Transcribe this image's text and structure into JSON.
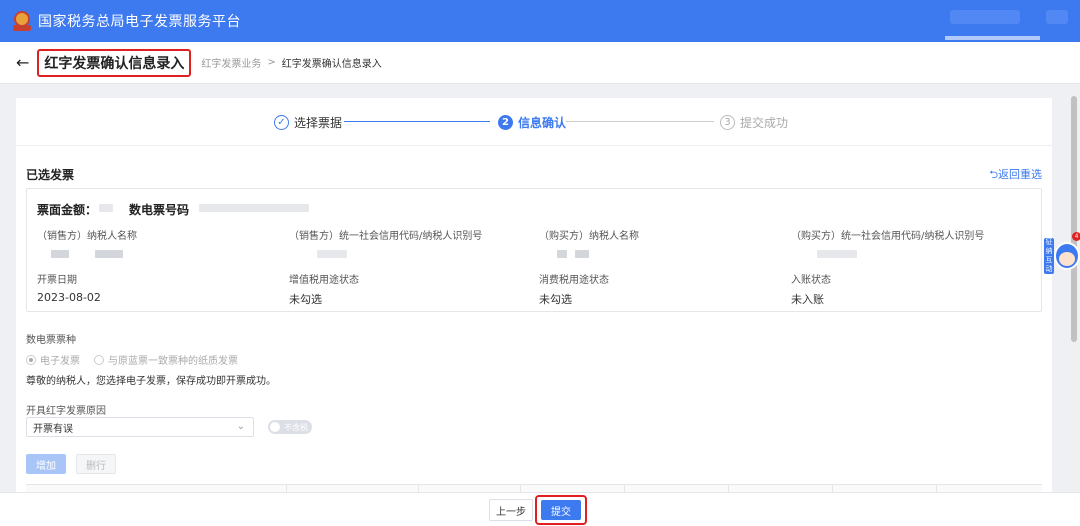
{
  "app": {
    "title": "国家税务总局电子发票服务平台"
  },
  "colors": {
    "primary": "#3d7af0",
    "highlight": "#e02020"
  },
  "header": {
    "page_title": "红字发票确认信息录入",
    "breadcrumb": [
      "红字发票业务",
      "红字发票确认信息录入"
    ],
    "breadcrumb_sep": ">",
    "back_icon": "arrow-left-icon"
  },
  "steps": [
    {
      "icon": "✓",
      "label": "选择票据",
      "state": "done"
    },
    {
      "icon": "2",
      "label": "信息确认",
      "state": "active"
    },
    {
      "icon": "3",
      "label": "提交成功",
      "state": "pending"
    }
  ],
  "selected": {
    "title": "已选发票",
    "reselect": "⮌返回重选",
    "amount_label": "票面金额：",
    "number_label": "数电票号码",
    "seller_name_label": "（销售方）纳税人名称",
    "seller_id_label": "（销售方）统一社会信用代码/纳税人识别号",
    "buyer_name_label": "（购买方）纳税人名称",
    "buyer_id_label": "（购买方）统一社会信用代码/纳税人识别号",
    "issue_date_label": "开票日期",
    "issue_date": "2023-08-02",
    "vat_label": "增值税用途状态",
    "vat_value": "未勾选",
    "consume_label": "消费税用途状态",
    "consume_value": "未勾选",
    "account_label": "入账状态",
    "account_value": "未入账"
  },
  "invoice_type": {
    "label": "数电票票种",
    "options": [
      "电子发票",
      "与原蓝票一致票种的纸质发票"
    ],
    "selected": "电子发票",
    "hint": "尊敬的纳税人，您选择电子发票，保存成功即开票成功。"
  },
  "reason": {
    "label": "开具红字发票原因",
    "value": "开票有误",
    "toggle_label": "不含税"
  },
  "table_actions": {
    "add": "增加",
    "delete": "删行"
  },
  "footer": {
    "prev": "上一步",
    "submit": "提交"
  },
  "assistant": {
    "side_text": "征纳互动",
    "badge": "4"
  }
}
